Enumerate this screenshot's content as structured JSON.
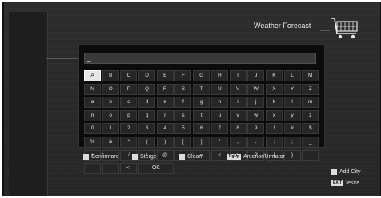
{
  "header": {
    "title": "Weather Forecast",
    "cart_icon": "shopping-cart-icon"
  },
  "input": {
    "value": "_"
  },
  "keyboard": {
    "keys": [
      "A",
      "B",
      "C",
      "D",
      "E",
      "F",
      "G",
      "H",
      "I",
      "J",
      "K",
      "L",
      "M",
      "N",
      "O",
      "P",
      "Q",
      "R",
      "S",
      "T",
      "U",
      "V",
      "W",
      "X",
      "Y",
      "Z",
      "a",
      "b",
      "c",
      "d",
      "e",
      "f",
      "g",
      "h",
      "i",
      "j",
      "k",
      "l",
      "m",
      "n",
      "o",
      "p",
      "q",
      "r",
      "s",
      "t",
      "u",
      "v",
      "w",
      "x",
      "y",
      "z",
      "0",
      "1",
      "2",
      "3",
      "4",
      "5",
      "6",
      "7",
      "8",
      "9",
      "!",
      "#",
      "$",
      "%",
      "&",
      "*",
      "(",
      ")",
      "[",
      "]",
      "'",
      ",",
      ".",
      ":",
      ";",
      "_",
      "+",
      "-",
      "/",
      "\\",
      "@",
      "~",
      "=",
      "<",
      ">",
      "?",
      "{",
      "}",
      "",
      "",
      "–",
      "<-",
      "OK"
    ],
    "selected_key": "A"
  },
  "legend": {
    "confirm": "Confirmare",
    "delete": "Sterge",
    "clean": "Clean",
    "page_badge": "PgUp",
    "page_label": "Anterior/Urmator"
  },
  "side": {
    "add_city": "Add City",
    "exit_badge": "EXIT",
    "exit_label": "Iesire"
  }
}
